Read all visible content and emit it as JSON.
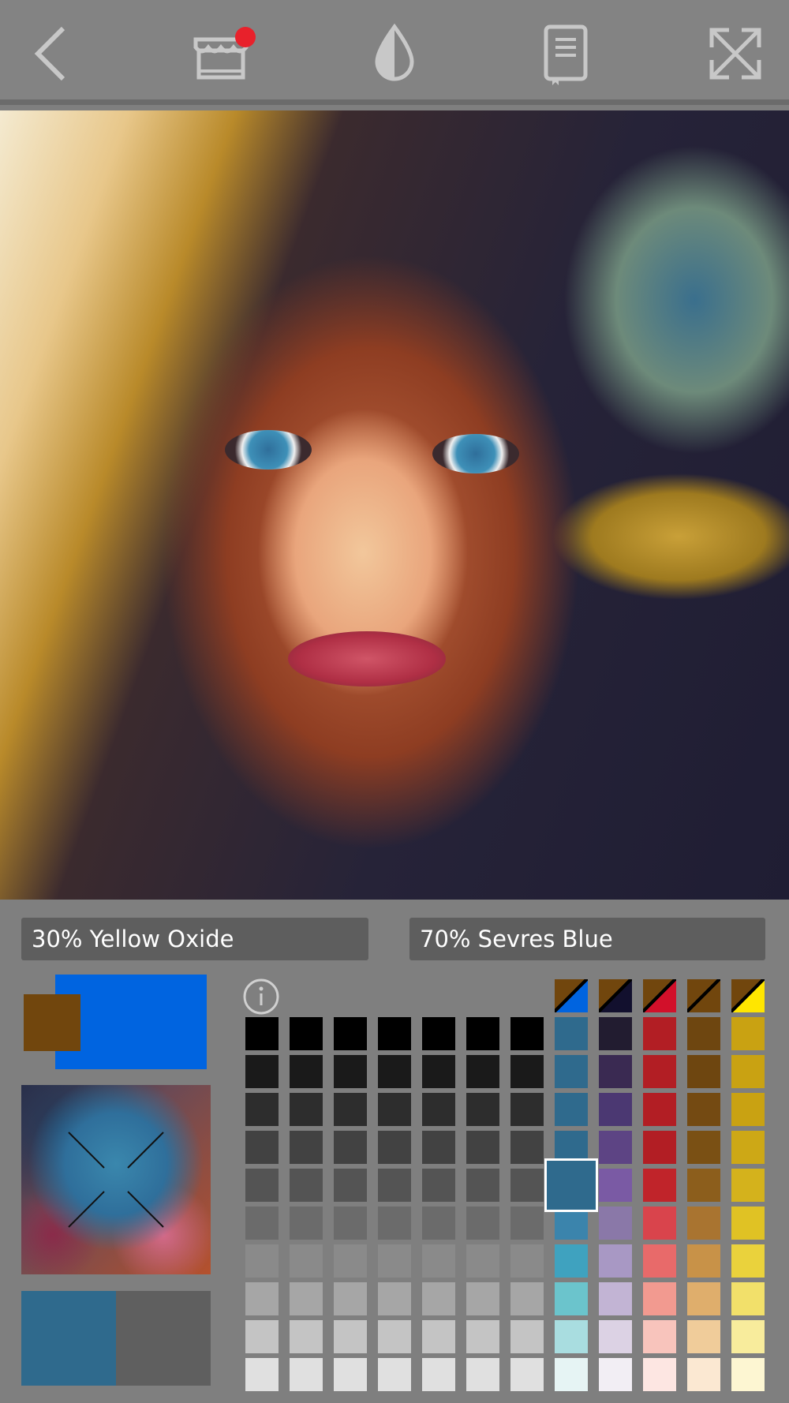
{
  "toolbar": {
    "items": [
      {
        "name": "back-icon"
      },
      {
        "name": "shop-icon",
        "has_badge": true
      },
      {
        "name": "color-drop-icon"
      },
      {
        "name": "guide-book-icon"
      },
      {
        "name": "fullscreen-icon"
      }
    ],
    "badge_color": "#e8212b"
  },
  "mix": {
    "left_label": "30% Yellow Oxide",
    "right_label": "70% Sevres Blue"
  },
  "current_colors": {
    "primary": "#0064e0",
    "secondary": "#71460d"
  },
  "comparison": {
    "target": "#2f6a8d",
    "current": "#5f5f5f"
  },
  "palette": {
    "grays": [
      "#000000",
      "#1a1a1a",
      "#2d2d2d",
      "#424242",
      "#545454",
      "#6b6b6b",
      "#8a8a8a",
      "#a6a6a6",
      "#c4c4c4",
      "#e0e0e0"
    ],
    "color_columns": [
      {
        "name": "blue",
        "head": "#0064e0",
        "shades": [
          "#2f6a8d",
          "#2f6a8d",
          "#2f6a8d",
          "#2f6a8d",
          "#2f6a8d",
          "#3b84ac",
          "#3fa2bf",
          "#6bc4cc",
          "#a9dde0",
          "#e6f4f4"
        ]
      },
      {
        "name": "violet",
        "head": "#12102e",
        "shades": [
          "#221c30",
          "#3a2a52",
          "#4b3872",
          "#5d4484",
          "#7a5aa4",
          "#8a78a8",
          "#a898c4",
          "#c2b4d4",
          "#dcd2e4",
          "#f2eef4"
        ]
      },
      {
        "name": "red",
        "head": "#d2102a",
        "shades": [
          "#b21e24",
          "#b21e24",
          "#b21e24",
          "#b21e24",
          "#c0242a",
          "#d9444c",
          "#e86a6a",
          "#f29a90",
          "#f8c4bc",
          "#fde6e2"
        ]
      },
      {
        "name": "brown",
        "head": "#71460d",
        "shades": [
          "#6e4610",
          "#6e4610",
          "#744a12",
          "#7a5014",
          "#8c5e1c",
          "#a97430",
          "#c89248",
          "#dfae6c",
          "#f0cc9a",
          "#fbe8d2"
        ]
      },
      {
        "name": "yellow",
        "head": "#ffe600",
        "shades": [
          "#c9a212",
          "#c9a212",
          "#c9a212",
          "#cda816",
          "#d4b21c",
          "#e0c224",
          "#ead23c",
          "#f2e06a",
          "#f8ec9c",
          "#fdf6d2"
        ]
      }
    ]
  }
}
